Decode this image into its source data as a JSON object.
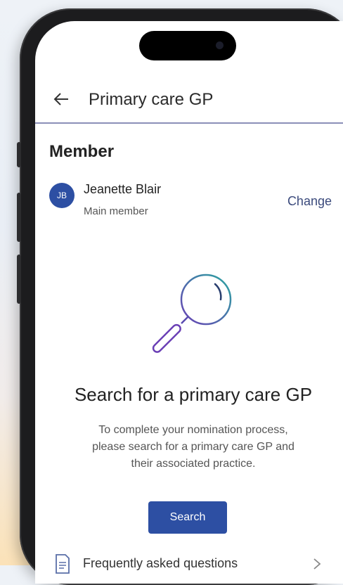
{
  "header": {
    "title": "Primary care GP"
  },
  "member": {
    "section_title": "Member",
    "initials": "JB",
    "name": "Jeanette Blair",
    "role": "Main member",
    "change_label": "Change"
  },
  "search": {
    "headline": "Search for a primary care GP",
    "description_line1": "To complete your nomination process,",
    "description_line2": "please search for a primary care GP and",
    "description_line3": "their associated practice.",
    "button_label": "Search"
  },
  "faq": {
    "label": "Frequently asked questions"
  },
  "icons": {
    "back": "arrow-left-icon",
    "illustration": "magnifying-glass-icon",
    "faq": "document-icon",
    "chevron": "chevron-right-icon"
  },
  "colors": {
    "primary": "#2d4fa3",
    "link": "#3b4a7c",
    "header_divider": "#8b8fb8",
    "illustration_gradient": [
      "#6a3fb5",
      "#2aa6a0"
    ]
  }
}
